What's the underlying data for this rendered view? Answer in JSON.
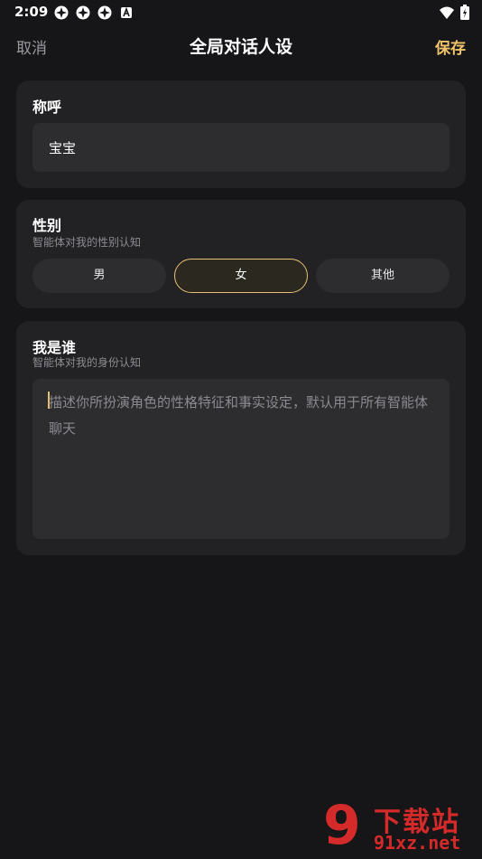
{
  "status_bar": {
    "time": "2:09",
    "notification_icons": [
      "app-icon",
      "app-icon",
      "app-icon",
      "a-badge-icon"
    ],
    "right_icons": [
      "wifi-icon",
      "battery-charging-icon"
    ]
  },
  "header": {
    "cancel_label": "取消",
    "title": "全局对话人设",
    "save_label": "保存"
  },
  "nickname": {
    "title": "称呼",
    "value": "宝宝"
  },
  "gender": {
    "title": "性别",
    "subtitle": "智能体对我的性别认知",
    "options": [
      "男",
      "女",
      "其他"
    ],
    "selected": "女"
  },
  "who_am_i": {
    "title": "我是谁",
    "subtitle": "智能体对我的身份认知",
    "placeholder": "描述你所扮演角色的性格特征和事实设定，默认用于所有智能体聊天"
  },
  "colors": {
    "background": "#161618",
    "card": "#222224",
    "input": "#2d2d30",
    "accent": "#f0c469",
    "muted_text": "#8c8c92"
  },
  "watermark": {
    "logo": "9",
    "text": "下载站",
    "url": "91xz.net"
  }
}
